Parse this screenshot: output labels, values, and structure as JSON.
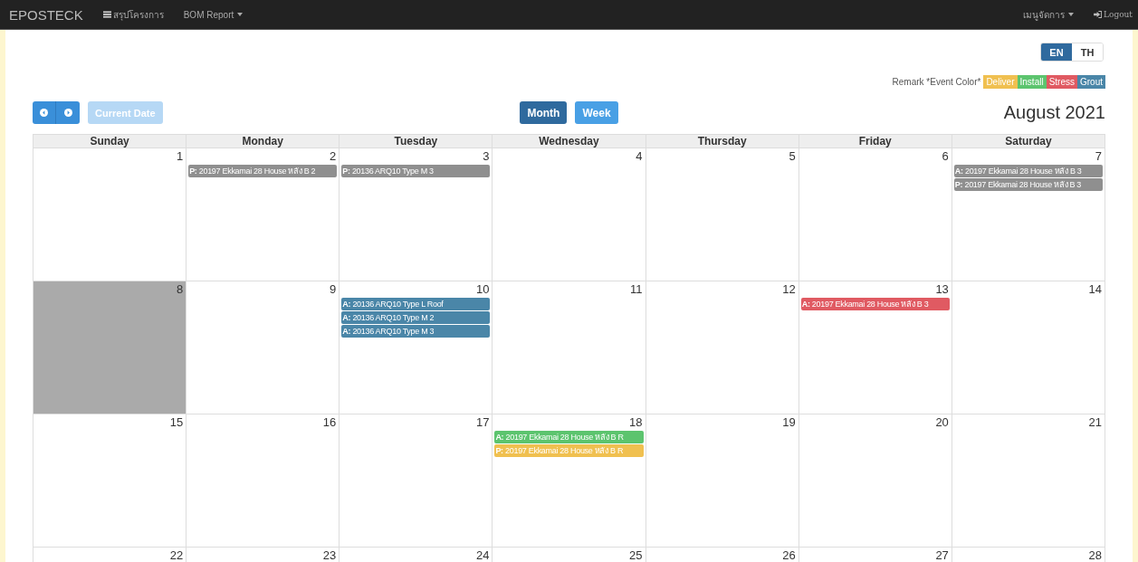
{
  "navbar": {
    "brand": "EPOSTECK",
    "items": [
      {
        "label": "สรุปโครงการ",
        "kind": "icon"
      },
      {
        "label": "BOM Report",
        "kind": "dropdown"
      }
    ],
    "right_items": [
      {
        "label": "เมนูจัดการ",
        "kind": "dropdown"
      },
      {
        "label": "Logout",
        "kind": "logout"
      }
    ]
  },
  "languages": [
    {
      "label": "EN",
      "selected": true
    },
    {
      "label": "TH",
      "selected": false
    }
  ],
  "legend": {
    "label": "Remark *Event Color*",
    "items": [
      {
        "label": "Deliver",
        "color": "#f0c050"
      },
      {
        "label": "Install",
        "color": "#5cc46e"
      },
      {
        "label": "Stress",
        "color": "#e05a62"
      },
      {
        "label": "Grout",
        "color": "#4a86a8"
      }
    ]
  },
  "toolbar": {
    "current_date": {
      "label": "Current Date",
      "disabled": true
    },
    "views": [
      {
        "label": "Month",
        "selected": true
      },
      {
        "label": "Week",
        "selected": false
      }
    ],
    "title": "August 2021"
  },
  "weekdays": [
    "Sunday",
    "Monday",
    "Tuesday",
    "Wednesday",
    "Thursday",
    "Friday",
    "Saturday"
  ],
  "weeks": [
    {
      "days": [
        {
          "date": "1",
          "today": false
        },
        {
          "date": "2",
          "today": false,
          "events": [
            {
              "text": "**P:** 20197 Ekkamai 28 House หลัง B 2",
              "color": "#8f8f8f"
            }
          ]
        },
        {
          "date": "3",
          "today": false,
          "events": [
            {
              "text": "**P:** 20136 ARQ10 Type M 3",
              "color": "#8f8f8f"
            }
          ]
        },
        {
          "date": "4",
          "today": false
        },
        {
          "date": "5",
          "today": false
        },
        {
          "date": "6",
          "today": false
        },
        {
          "date": "7",
          "today": false,
          "events": [
            {
              "text": "**A:** 20197 Ekkamai 28 House หลัง B 3",
              "color": "#8f8f8f"
            },
            {
              "text": "**P:** 20197 Ekkamai 28 House หลัง B 3",
              "color": "#8f8f8f"
            }
          ]
        }
      ]
    },
    {
      "days": [
        {
          "date": "8",
          "today": true
        },
        {
          "date": "9",
          "today": false
        },
        {
          "date": "10",
          "today": false,
          "events": [
            {
              "text": "**A:** 20136 ARQ10 Type L Roof",
              "color": "#4a86a8"
            },
            {
              "text": "**A:** 20136 ARQ10 Type M 2",
              "color": "#4a86a8"
            },
            {
              "text": "**A:** 20136 ARQ10 Type M 3",
              "color": "#4a86a8"
            }
          ]
        },
        {
          "date": "11",
          "today": false
        },
        {
          "date": "12",
          "today": false
        },
        {
          "date": "13",
          "today": false,
          "events": [
            {
              "text": "**A:** 20197 Ekkamai 28 House หลัง B 3",
              "color": "#e05a62"
            }
          ]
        },
        {
          "date": "14",
          "today": false
        }
      ]
    },
    {
      "days": [
        {
          "date": "15",
          "today": false
        },
        {
          "date": "16",
          "today": false
        },
        {
          "date": "17",
          "today": false
        },
        {
          "date": "18",
          "today": false,
          "events": [
            {
              "text": "**A:** 20197 Ekkamai 28 House หลัง B R",
              "color": "#5cc46e"
            },
            {
              "text": "**P:** 20197 Ekkamai 28 House หลัง B R",
              "color": "#f0c050"
            }
          ]
        },
        {
          "date": "19",
          "today": false
        },
        {
          "date": "20",
          "today": false
        },
        {
          "date": "21",
          "today": false
        }
      ]
    },
    {
      "days": [
        {
          "date": "22",
          "today": false
        },
        {
          "date": "23",
          "today": false
        },
        {
          "date": "24",
          "today": false
        },
        {
          "date": "25",
          "today": false
        },
        {
          "date": "26",
          "today": false
        },
        {
          "date": "27",
          "today": false
        },
        {
          "date": "28",
          "today": false
        }
      ]
    }
  ]
}
